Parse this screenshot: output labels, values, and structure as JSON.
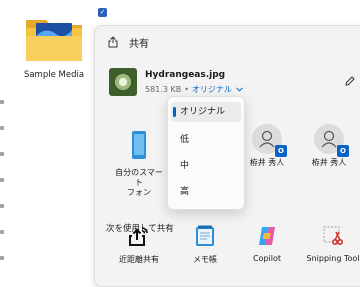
{
  "desktop": {
    "folder_label": "Sample Media"
  },
  "share_panel": {
    "title": "共有",
    "file": {
      "name": "Hydrangeas.jpg",
      "size": "581.3 KB",
      "separator": "•",
      "quality": "オリジナル"
    },
    "quality_options": [
      "オリジナル",
      "低",
      "中",
      "高"
    ],
    "selected_quality_index": 0,
    "contacts": [
      {
        "label_line1": "自分のスマート",
        "label_line2": "フォン",
        "icon": "phone-icon"
      },
      {
        "label": "栫井 秀人",
        "icon": "person-icon",
        "badge": "O"
      },
      {
        "label": "栫井 秀人",
        "icon": "person-icon",
        "badge": "O"
      }
    ],
    "section_label": "次を使用して共有",
    "apps": [
      {
        "label": "近距離共有",
        "icon": "nearby-share-icon"
      },
      {
        "label": "メモ帳",
        "icon": "notepad-icon"
      },
      {
        "label": "Copilot",
        "icon": "copilot-icon"
      },
      {
        "label": "Snipping Tool",
        "icon": "snipping-tool-icon"
      }
    ]
  },
  "colors": {
    "accent": "#0067c0",
    "panel_bg": "#f3f3f3",
    "folder": "#f5c443"
  }
}
